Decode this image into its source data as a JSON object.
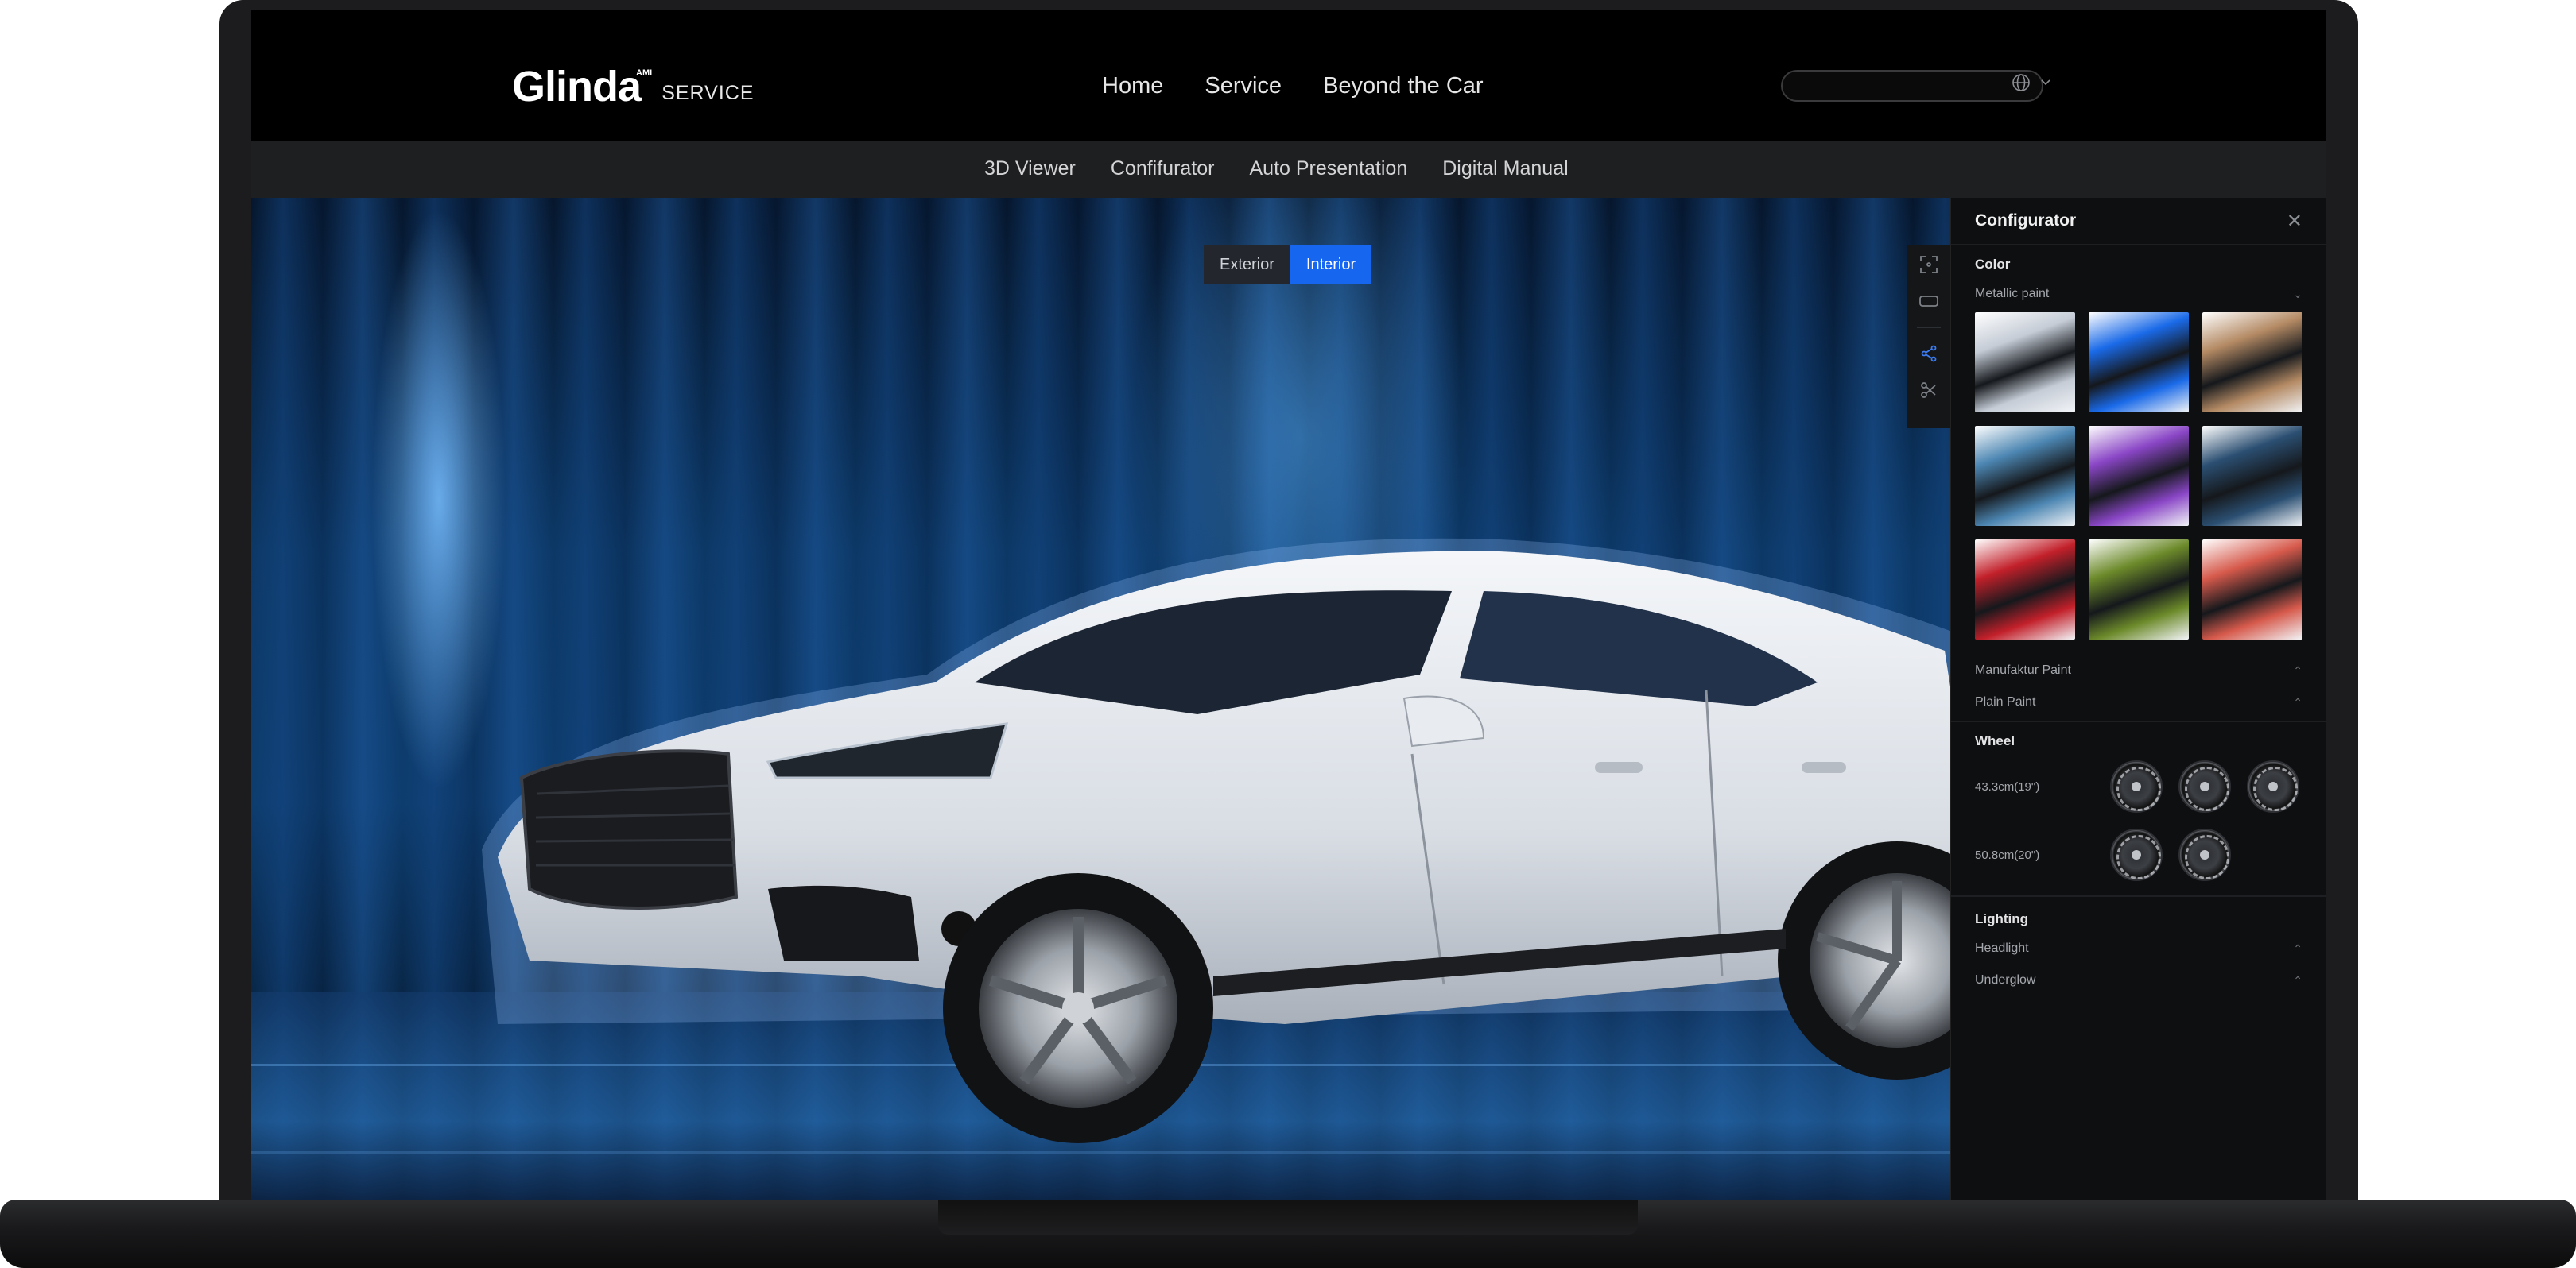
{
  "header": {
    "logo_word": "Glinda",
    "logo_super": "AMI",
    "logo_suffix": "SERVICE",
    "nav": [
      "Home",
      "Service",
      "Beyond the Car"
    ],
    "search_placeholder": ""
  },
  "subnav": [
    "3D Viewer",
    "Confifurator",
    "Auto Presentation",
    "Digital Manual"
  ],
  "viewer": {
    "view_toggle": {
      "options": [
        "Exterior",
        "Interior"
      ],
      "selected": "Interior"
    },
    "toolbar_icons": [
      "focus-frame-icon",
      "aspect-ratio-icon",
      "share-icon",
      "scissors-icon"
    ]
  },
  "configurator": {
    "title": "Configurator",
    "color": {
      "title": "Color",
      "metallic_label": "Metallic paint",
      "swatches": [
        {
          "name": "silver",
          "color": "#c5ccd6"
        },
        {
          "name": "blue",
          "color": "#1a6ae8"
        },
        {
          "name": "bronze",
          "color": "#b48a64"
        },
        {
          "name": "steel-blue",
          "color": "#4c86b2"
        },
        {
          "name": "purple",
          "color": "#8a46c6"
        },
        {
          "name": "navy",
          "color": "#2b4f72"
        },
        {
          "name": "red",
          "color": "#c2202a"
        },
        {
          "name": "green",
          "color": "#6c8a2a"
        },
        {
          "name": "coral",
          "color": "#d65a4c"
        }
      ],
      "manufaktur_label": "Manufaktur Paint",
      "plain_label": "Plain Paint"
    },
    "wheel": {
      "title": "Wheel",
      "rows": [
        {
          "label": "43.3cm(19\")",
          "count": 3
        },
        {
          "label": "50.8cm(20\")",
          "count": 2
        }
      ]
    },
    "lighting": {
      "title": "Lighting",
      "items": [
        "Headlight",
        "Underglow"
      ]
    }
  }
}
